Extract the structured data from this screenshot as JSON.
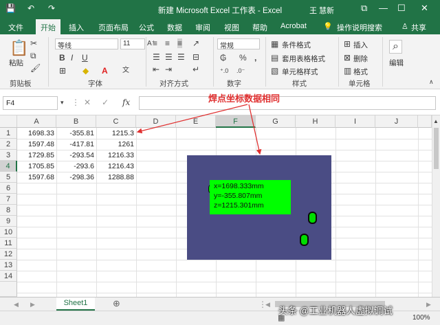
{
  "title": "新建 Microsoft Excel 工作表 - Excel",
  "user": "王 慧新",
  "window_controls": {
    "restore": "⧉",
    "min": "—",
    "max": "☐",
    "close": "✕"
  },
  "quick_access": {
    "save": "💾",
    "undo": "↶",
    "redo": "↷"
  },
  "menu": [
    "文件",
    "开始",
    "插入",
    "页面布局",
    "公式",
    "数据",
    "审阅",
    "视图",
    "帮助",
    "Acrobat"
  ],
  "menu_active": "开始",
  "tell_me": "操作说明搜索",
  "share": "共享",
  "ribbon": {
    "paste": "粘贴",
    "font_name": "等线",
    "font_size": "11",
    "number_format": "常规",
    "cond_format": "条件格式",
    "table_format": "套用表格格式",
    "cell_style": "单元格样式",
    "insert": "插入",
    "delete": "删除",
    "format": "格式",
    "edit": "编辑",
    "groups": {
      "clipboard": "剪贴板",
      "font": "字体",
      "align": "对齐方式",
      "number": "数字",
      "styles": "样式",
      "cells": "单元格"
    }
  },
  "name_box": "F4",
  "fx": "fx",
  "columns": [
    "A",
    "B",
    "C",
    "D",
    "E",
    "F",
    "G",
    "H",
    "I",
    "J"
  ],
  "selected_col": "F",
  "selected_row": 4,
  "rows": [
    {
      "n": 1,
      "A": "1698.33",
      "B": "-355.81",
      "C": "1215.3"
    },
    {
      "n": 2,
      "A": "1597.48",
      "B": "-417.81",
      "C": "1261"
    },
    {
      "n": 3,
      "A": "1729.85",
      "B": "-293.54",
      "C": "1216.33"
    },
    {
      "n": 4,
      "A": "1705.85",
      "B": "-293.6",
      "C": "1216.43"
    },
    {
      "n": 5,
      "A": "1597.68",
      "B": "-298.36",
      "C": "1288.88"
    }
  ],
  "row_numbers": [
    1,
    2,
    3,
    4,
    5,
    6,
    7,
    8,
    9,
    10,
    11,
    12,
    13,
    14
  ],
  "annotation": "焊点坐标数据相同",
  "callout": {
    "x": "x=1698.333mm",
    "y": "y=-355.807mm",
    "z": "z=1215.301mm"
  },
  "sheet_tab": "Sheet1",
  "add_sheet": "⊕",
  "zoom": "100%",
  "watermark": "头条 @工业机器人虚拟调试",
  "colors": {
    "excel_green": "#217346",
    "annotation_red": "#e03030",
    "panel_bg": "#4a4c84",
    "callout_green": "#00ff00"
  }
}
